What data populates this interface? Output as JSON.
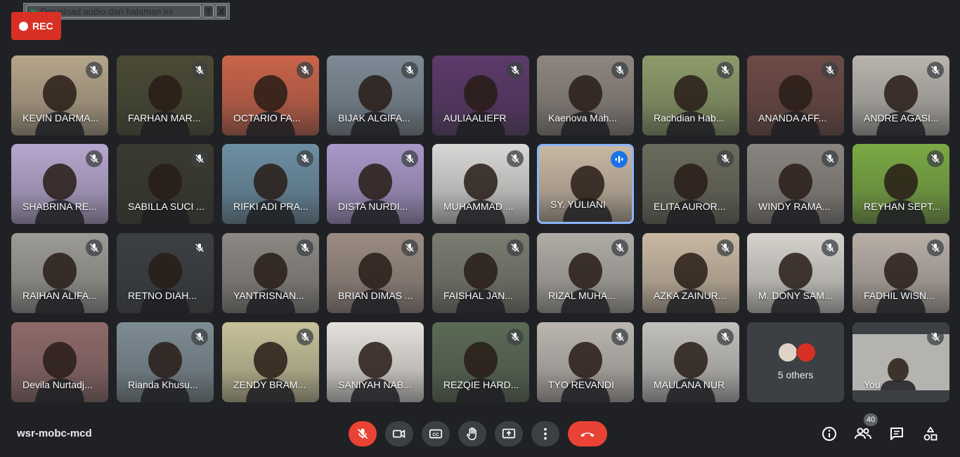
{
  "download_bar": {
    "label": "Download audio dari halaman ini",
    "help": "?",
    "close": "X"
  },
  "rec": {
    "label": "REC"
  },
  "participants": [
    {
      "name": "KEVIN DARMA...",
      "bg": "#b5a58a",
      "muted": true
    },
    {
      "name": "FARHAN MAR...",
      "bg": "#4a4a35",
      "muted": true
    },
    {
      "name": "OCTARIO FA...",
      "bg": "#c9644a",
      "muted": true
    },
    {
      "name": "BIJAK ALGIFA...",
      "bg": "#7d8a95",
      "muted": true
    },
    {
      "name": "AULIAALIEFR",
      "bg": "#5c3a6a",
      "muted": true
    },
    {
      "name": "Kaenova Mah...",
      "bg": "#8e8680",
      "muted": true
    },
    {
      "name": "Rachdian Hab...",
      "bg": "#8d9b6a",
      "muted": true
    },
    {
      "name": "ANANDA AFF...",
      "bg": "#6d4a45",
      "muted": true
    },
    {
      "name": "ANDRE AGASI...",
      "bg": "#b8b4ae",
      "muted": true
    },
    {
      "name": "SHABRINA RE...",
      "bg": "#b7a8cf",
      "muted": true
    },
    {
      "name": "SABILLA SUCI ...",
      "bg": "#3a3a30",
      "muted": true
    },
    {
      "name": "RIFKI ADI PRA...",
      "bg": "#6d8fa3",
      "muted": true
    },
    {
      "name": "DISTA NURDI...",
      "bg": "#a998c9",
      "muted": true
    },
    {
      "name": "MUHAMMAD ...",
      "bg": "#d8d8d6",
      "muted": true
    },
    {
      "name": "SY. YULIANI",
      "bg": "#c8b8a4",
      "muted": false,
      "speaking": true
    },
    {
      "name": "ELITA AUROR...",
      "bg": "#6a6a5c",
      "muted": true
    },
    {
      "name": "WINDY RAMA...",
      "bg": "#8a8580",
      "muted": true
    },
    {
      "name": "REYHAN SEPT...",
      "bg": "#7ba944",
      "muted": true
    },
    {
      "name": "RAIHAN ALIFA...",
      "bg": "#9c9b96",
      "muted": true
    },
    {
      "name": "RETNO DIAH...",
      "bg": "#3c4043",
      "muted": true
    },
    {
      "name": "YANTRISNAN...",
      "bg": "#8c8883",
      "muted": true
    },
    {
      "name": "BRIAN DIMAS ...",
      "bg": "#9a8b82",
      "muted": true
    },
    {
      "name": "FAISHAL JAN...",
      "bg": "#7a7c70",
      "muted": true
    },
    {
      "name": "RIZAL MUHA...",
      "bg": "#b0aca6",
      "muted": true
    },
    {
      "name": "AZKA ZAINUR...",
      "bg": "#c9b9a3",
      "muted": true
    },
    {
      "name": "M. DONY SAM...",
      "bg": "#d6d3cd",
      "muted": true
    },
    {
      "name": "FADHIL WISN...",
      "bg": "#b8aea6",
      "muted": true
    },
    {
      "name": "Devila Nurtadj...",
      "bg": "#8f6a6a",
      "muted": false
    },
    {
      "name": "Rianda Khusu...",
      "bg": "#7e8c94",
      "muted": true
    },
    {
      "name": "ZENDY BRAM...",
      "bg": "#c7c29a",
      "muted": true
    },
    {
      "name": "SANIYAH NAB...",
      "bg": "#e5e1dc",
      "muted": false
    },
    {
      "name": "REZQIE HARD...",
      "bg": "#5b6a55",
      "muted": true
    },
    {
      "name": "TYO REVANDI",
      "bg": "#bbb6b0",
      "muted": true
    },
    {
      "name": "MAULANA NUR",
      "bg": "#c2c0bc",
      "muted": true
    }
  ],
  "others_tile": {
    "label": "5 others",
    "avatar_colors": [
      "#e0d2c4",
      "#d93025"
    ]
  },
  "self_tile": {
    "name": "You",
    "bg": "#b5b3b0",
    "muted": true
  },
  "meeting_code": "wsr-mobc-mcd",
  "controls": [
    {
      "icon": "mic-off-icon",
      "state": "muted",
      "color": "#ea4335"
    },
    {
      "icon": "camera-icon"
    },
    {
      "icon": "captions-icon"
    },
    {
      "icon": "raise-hand-icon"
    },
    {
      "icon": "present-screen-icon"
    },
    {
      "icon": "more-options-icon"
    },
    {
      "icon": "end-call-icon",
      "color": "#ea4335"
    }
  ],
  "right_controls": {
    "info_icon": "info-icon",
    "people_icon": "people-icon",
    "people_count": "40",
    "chat_icon": "chat-icon",
    "activities_icon": "activities-icon"
  }
}
